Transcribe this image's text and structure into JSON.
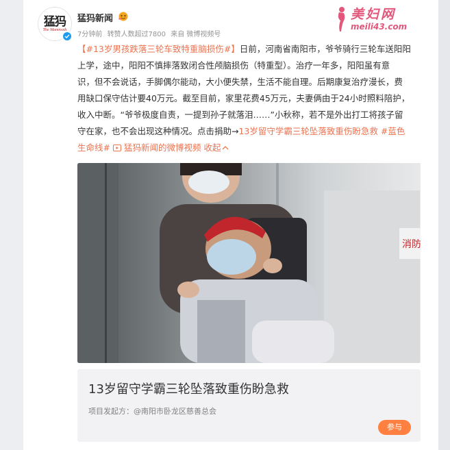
{
  "post": {
    "author": {
      "name": "猛犸新闻",
      "avatar_logo_text": "猛犸",
      "avatar_logo_en": "The Mammoth"
    },
    "meta": {
      "time": "7分钟前",
      "reposts": "转赞人数超过7800",
      "source": "来自 微博视频号"
    },
    "watermark": {
      "title": "美妇网",
      "url": "meili43.com"
    },
    "body": {
      "hashtag_title": "【#13岁男孩跌落三轮车致特重脑损伤#】",
      "line1_rest": "日前，河南省南阳市，爷爷骑行三轮车送阳阳",
      "line2": "上学，途中，阳阳不慎摔落致闭合性颅脑损伤（特重型）。治疗一年多，阳阳虽有意",
      "line3": "识，但不会说话，手脚偶尔能动，大小便失禁，生活不能自理。后期康复治疗漫长，费",
      "line4": "用缺口保守估计要40万元。截至目前，家里花费45万元，夫妻俩由于24小时照料陪护，",
      "line5": "收入中断。“爷爷极度自责，一提到孙子就落泪……”小秋称，若不是外出打工将孩子留",
      "line6_a": "守在家，也不会出现这种情况。点击捐助→",
      "line6_link": "13岁留守学霸三轮坠落致重伤盼急救",
      "line6_tag": " #蓝色",
      "line7_tag": "生命线#",
      "line7_video": " 猛犸新闻的微博视频",
      "line7_collapse": " 收起"
    },
    "link_card": {
      "title": "13岁留守学霸三轮坠落致重伤盼急救",
      "sponsor": "项目发起方：@南阳市卧龙区慈善总会",
      "button": "参与"
    },
    "photo": {
      "sign_text": "消防"
    }
  },
  "colors": {
    "link": "#eb7350",
    "verify": "#1e9bf0",
    "button": "#ff8040",
    "watermark": "#e2577a"
  }
}
